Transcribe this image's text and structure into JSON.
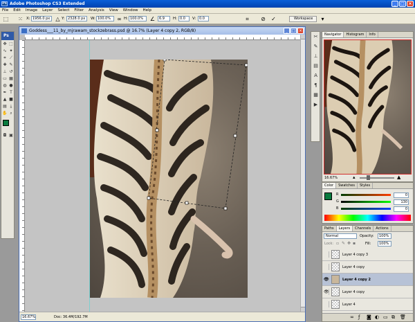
{
  "app": {
    "title": "Adobe Photoshop CS3 Extended",
    "logo": "Ps"
  },
  "window_controls": {
    "minimize": "_",
    "maximize": "□",
    "close": "×"
  },
  "menu": [
    "File",
    "Edit",
    "Image",
    "Layer",
    "Select",
    "Filter",
    "Analysis",
    "View",
    "Window",
    "Help"
  ],
  "options_bar": {
    "x_label": "X:",
    "x_value": "1956.0 px",
    "y_label": "Y:",
    "y_value": "2328.0 px",
    "w_label": "W:",
    "w_value": "100.0%",
    "h_label": "H:",
    "h_value": "100.0%",
    "angle_value": "6.9",
    "h2_label": "H:",
    "h2_value": "0.0",
    "v_label": "V:",
    "v_value": "0.0",
    "workspace": "Workspace"
  },
  "document": {
    "title": "Goddess___11_by_mjrawam_stockzebrass.psd @ 16.7% (Layer 4 copy 2, RGB/8)",
    "zoom": "16.67%",
    "doc_info": "Doc: 36.4M/192.7M"
  },
  "navigator": {
    "tabs": [
      "Navigator",
      "Histogram",
      "Info"
    ],
    "zoom": "16.67%"
  },
  "color_panel": {
    "tabs": [
      "Color",
      "Swatches",
      "Styles"
    ],
    "r_label": "R",
    "g_label": "G",
    "b_label": "B",
    "r_value": "0",
    "g_value": "130",
    "b_value": "0",
    "foreground": "#0a7a3e"
  },
  "layers_panel": {
    "tabs": [
      "Paths",
      "Layers",
      "Channels",
      "Actions"
    ],
    "blend_mode": "Normal",
    "opacity_label": "Opacity:",
    "opacity_value": "100%",
    "lock_label": "Lock:",
    "fill_label": "Fill:",
    "fill_value": "100%",
    "layers": [
      {
        "name": "Layer 4 copy 3",
        "visible": false,
        "selected": false
      },
      {
        "name": "Layer 4 copy",
        "visible": false,
        "selected": false
      },
      {
        "name": "Layer 4 copy 2",
        "visible": true,
        "selected": true
      },
      {
        "name": "Layer 4 copy",
        "visible": true,
        "selected": false
      },
      {
        "name": "Layer 4",
        "visible": false,
        "selected": false
      }
    ]
  },
  "colors": {
    "titlebar": "#0a4fd0",
    "selection": "#b7c2d6",
    "navigator_frame": "#d12d2d"
  }
}
